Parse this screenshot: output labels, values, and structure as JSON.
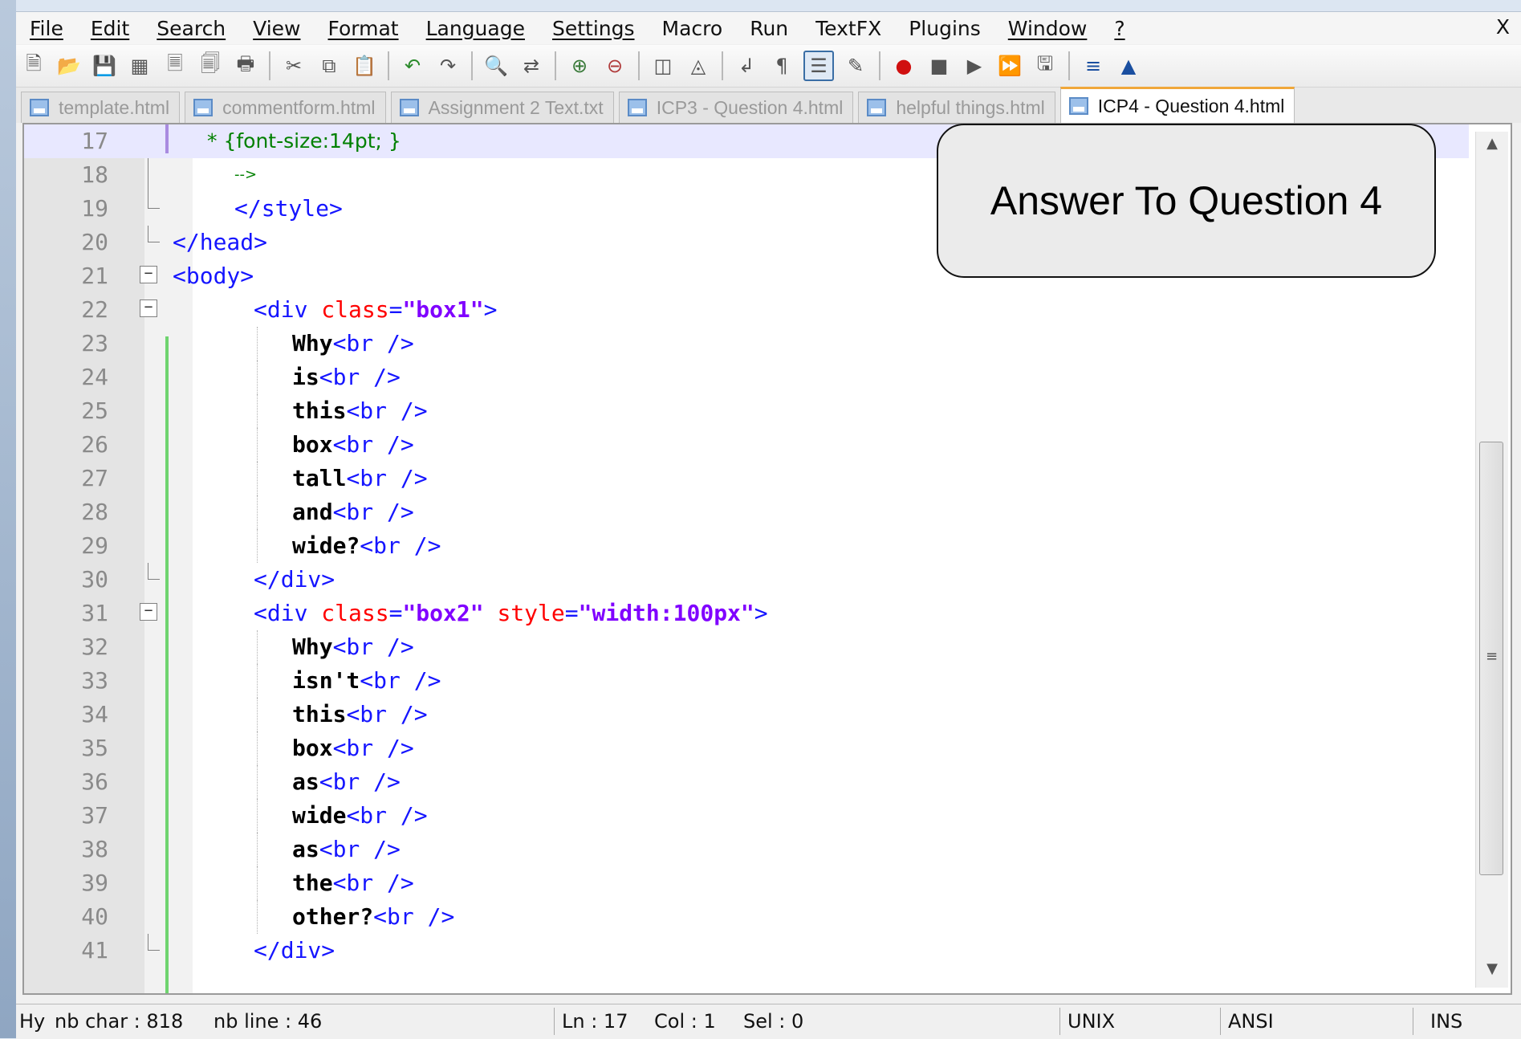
{
  "menubar": {
    "items": [
      "File",
      "Edit",
      "Search",
      "View",
      "Format",
      "Language",
      "Settings",
      "Macro",
      "Run",
      "TextFX",
      "Plugins",
      "Window",
      "?"
    ],
    "close": "X"
  },
  "toolbar": {
    "icons": [
      "new-file-icon",
      "open-file-icon",
      "save-icon",
      "save-all-icon",
      "close-icon",
      "close-all-icon",
      "print-icon",
      "cut-icon",
      "copy-icon",
      "paste-icon",
      "undo-icon",
      "redo-icon",
      "find-icon",
      "replace-icon",
      "zoom-in-icon",
      "zoom-out-icon",
      "sync-vertical-icon",
      "sync-horizontal-icon",
      "word-wrap-icon",
      "show-all-chars-icon",
      "indent-guide-icon",
      "user-lang-icon",
      "record-macro-icon",
      "stop-record-icon",
      "play-macro-icon",
      "run-macro-multiple-icon",
      "save-macro-icon",
      "fold-all-icon",
      "unfold-icon"
    ]
  },
  "tabs": [
    {
      "label": "template.html",
      "active": false
    },
    {
      "label": "commentform.html",
      "active": false
    },
    {
      "label": "Assignment 2 Text.txt",
      "active": false
    },
    {
      "label": "ICP3 - Question 4.html",
      "active": false
    },
    {
      "label": "helpful things.html",
      "active": false
    },
    {
      "label": "ICP4 - Question 4.html",
      "active": true
    }
  ],
  "editor": {
    "lines": [
      {
        "n": "17",
        "code": "* {font-size:14pt; }"
      },
      {
        "n": "18",
        "code": "-->"
      },
      {
        "n": "19",
        "code": "</style>"
      },
      {
        "n": "20",
        "code": "</head>"
      },
      {
        "n": "21",
        "code": "<body>"
      },
      {
        "n": "22",
        "code": "<div class=\"box1\">"
      },
      {
        "n": "23",
        "code": "Why<br />"
      },
      {
        "n": "24",
        "code": "is<br />"
      },
      {
        "n": "25",
        "code": "this<br />"
      },
      {
        "n": "26",
        "code": "box<br />"
      },
      {
        "n": "27",
        "code": "tall<br />"
      },
      {
        "n": "28",
        "code": "and<br />"
      },
      {
        "n": "29",
        "code": "wide?<br />"
      },
      {
        "n": "30",
        "code": "</div>"
      },
      {
        "n": "31",
        "code": "<div class=\"box2\" style=\"width:100px\">"
      },
      {
        "n": "32",
        "code": "Why<br />"
      },
      {
        "n": "33",
        "code": "isn't<br />"
      },
      {
        "n": "34",
        "code": "this<br />"
      },
      {
        "n": "35",
        "code": "box<br />"
      },
      {
        "n": "36",
        "code": "as<br />"
      },
      {
        "n": "37",
        "code": "wide<br />"
      },
      {
        "n": "38",
        "code": "as<br />"
      },
      {
        "n": "39",
        "code": "the<br />"
      },
      {
        "n": "40",
        "code": "other?<br />"
      },
      {
        "n": "41",
        "code": "</div>"
      }
    ]
  },
  "callout": {
    "text": "Answer To Question 4"
  },
  "statusbar": {
    "hy": "Hy",
    "nb_char": "nb char : 818",
    "nb_line": "nb line : 46",
    "ln": "Ln : 17",
    "col": "Col : 1",
    "sel": "Sel : 0",
    "eol": "UNIX",
    "encoding": "ANSI",
    "mode": "INS"
  },
  "colors": {
    "tag": "#1515ff",
    "attribute": "#ff0000",
    "value": "#8000ff",
    "css": "#008000",
    "active_tab_accent": "#f0a73a"
  }
}
